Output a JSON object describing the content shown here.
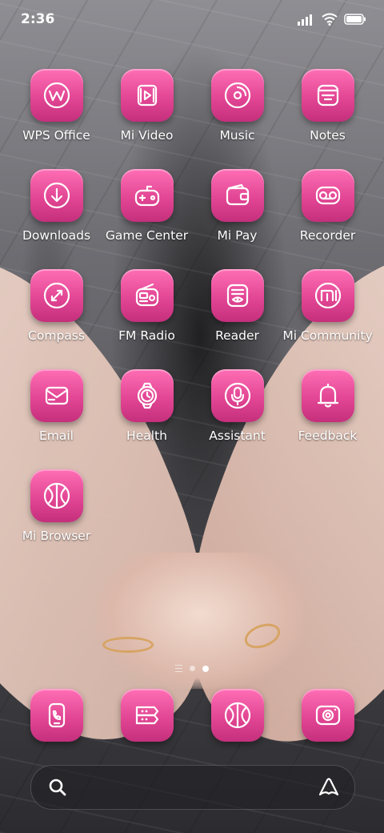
{
  "status_bar": {
    "time": "2:36"
  },
  "apps": [
    {
      "label": "WPS Office",
      "icon": "wps-office-icon"
    },
    {
      "label": "Mi Video",
      "icon": "mi-video-icon"
    },
    {
      "label": "Music",
      "icon": "music-icon"
    },
    {
      "label": "Notes",
      "icon": "notes-icon"
    },
    {
      "label": "Downloads",
      "icon": "downloads-icon"
    },
    {
      "label": "Game Center",
      "icon": "game-center-icon"
    },
    {
      "label": "Mi Pay",
      "icon": "mi-pay-icon"
    },
    {
      "label": "Recorder",
      "icon": "recorder-icon"
    },
    {
      "label": "Compass",
      "icon": "compass-icon"
    },
    {
      "label": "FM Radio",
      "icon": "fm-radio-icon"
    },
    {
      "label": "Reader",
      "icon": "reader-icon"
    },
    {
      "label": "Mi Community",
      "icon": "mi-community-icon"
    },
    {
      "label": "Email",
      "icon": "email-icon"
    },
    {
      "label": "Health",
      "icon": "health-icon"
    },
    {
      "label": "Assistant",
      "icon": "assistant-icon"
    },
    {
      "label": "Feedback",
      "icon": "feedback-icon"
    },
    {
      "label": "Mi Browser",
      "icon": "mi-browser-icon"
    }
  ],
  "dock": [
    {
      "icon": "phone-icon"
    },
    {
      "icon": "messages-icon"
    },
    {
      "icon": "browser-icon"
    },
    {
      "icon": "camera-icon"
    }
  ],
  "page_indicator": {
    "pages": 2,
    "active": 2
  },
  "colors": {
    "icon_gradient_top": "#ff6fb5",
    "icon_gradient_bottom": "#c52f7c",
    "label": "#ffffff"
  }
}
